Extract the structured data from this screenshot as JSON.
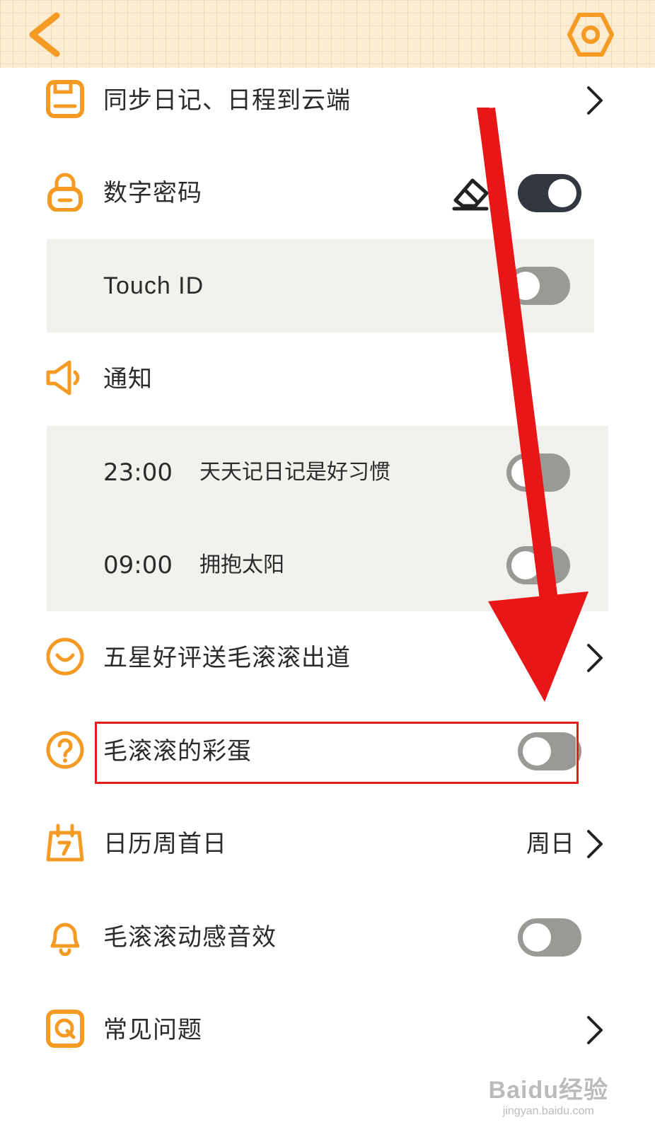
{
  "colors": {
    "accent": "#f59a23",
    "toggle_off": "#9a9995",
    "toggle_on": "#333740",
    "annotation_red": "#e11d1d"
  },
  "topbar": {
    "back_icon": "chevron-left-icon",
    "settings_icon": "hexagon-gear-icon"
  },
  "settings": {
    "sync": {
      "label": "同步日记、日程到云端",
      "icon": "save-icon"
    },
    "passcode": {
      "label": "数字密码",
      "icon": "lock-icon",
      "eraser_icon": "eraser-icon",
      "enabled": true
    },
    "touch_id": {
      "label": "Touch ID",
      "enabled": false
    },
    "notify": {
      "label": "通知",
      "icon": "speaker-icon"
    },
    "reminders": [
      {
        "time": "23:00",
        "text": "天天记日记是好习惯",
        "enabled": false
      },
      {
        "time": "09:00",
        "text": "拥抱太阳",
        "enabled": false
      }
    ],
    "rate": {
      "label": "五星好评送毛滚滚出道",
      "icon": "smile-icon"
    },
    "easter_egg": {
      "label": "毛滚滚的彩蛋",
      "icon": "question-icon",
      "enabled": false
    },
    "week_start": {
      "label": "日历周首日",
      "icon": "calendar-icon",
      "value": "周日"
    },
    "sound": {
      "label": "毛滚滚动感音效",
      "icon": "bell-icon",
      "enabled": false
    },
    "faq": {
      "label": "常见问题",
      "icon": "q-icon"
    }
  },
  "watermark": {
    "brand": "Baidu经验",
    "url": "jingyan.baidu.com"
  }
}
